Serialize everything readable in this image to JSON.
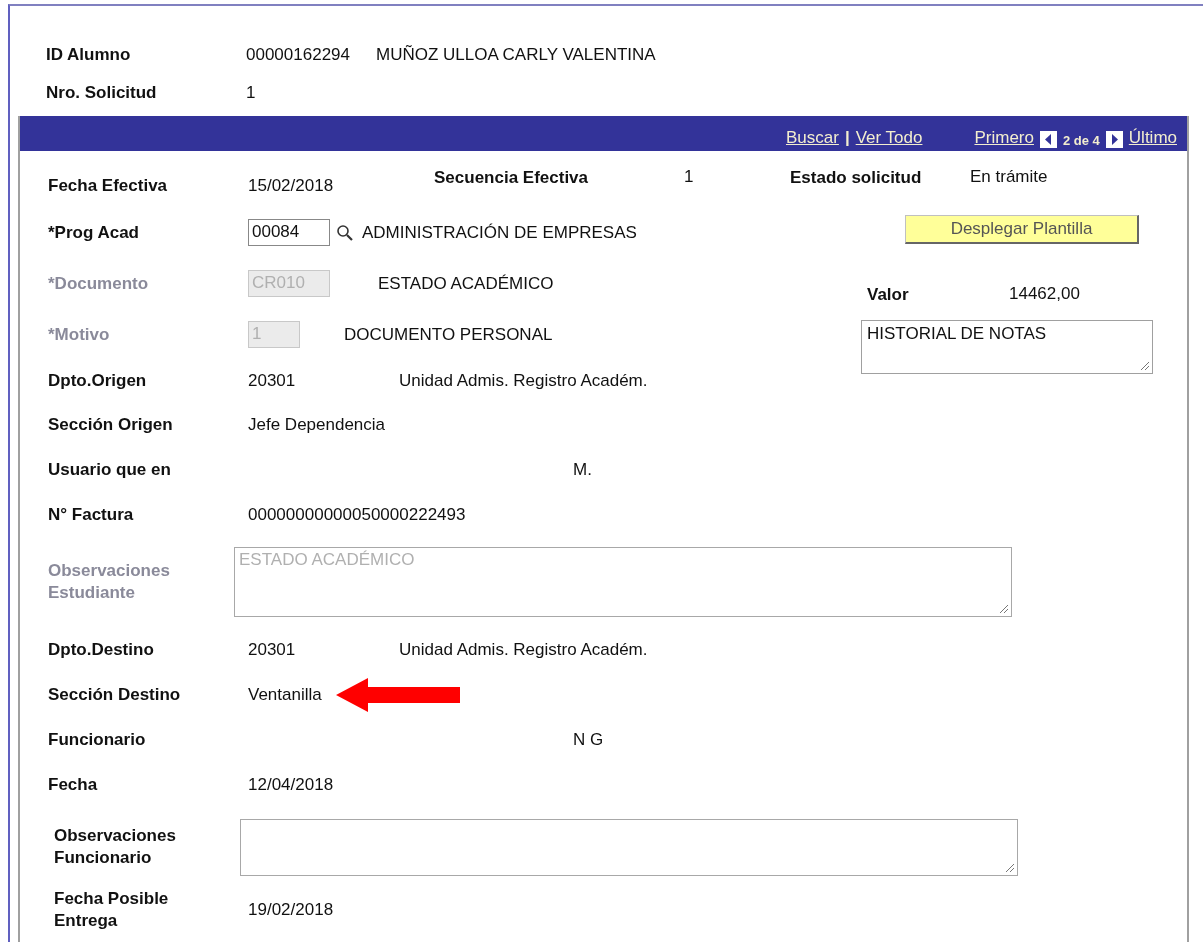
{
  "header": [
    {
      "label": "ID Alumno",
      "value": "00000162294",
      "description": "MUÑOZ ULLOA CARLY VALENTINA"
    },
    {
      "label": "Nro. Solicitud",
      "value": "1"
    }
  ],
  "panel": {
    "links": [
      {
        "kind": "link",
        "text": "Buscar"
      },
      {
        "kind": "sep",
        "text": "|"
      },
      {
        "kind": "link",
        "text": "Ver Todo"
      },
      {
        "kind": "gap"
      },
      {
        "kind": "link",
        "text": "Primero"
      },
      {
        "kind": "prev"
      },
      {
        "kind": "count",
        "text": "2 de 4"
      },
      {
        "kind": "next"
      },
      {
        "kind": "link",
        "text": "Último"
      }
    ],
    "first_row": {
      "label": "Fecha Efectiva",
      "value": "15/02/2018",
      "seq_label": "Secuencia Efectiva",
      "seq_value": "1",
      "status_label": "Estado solicitud",
      "status_value": "En trámite"
    },
    "upper_rows": [
      {
        "kind": "lookup",
        "label": "*Prog Acad",
        "value": "00084",
        "disabled": false,
        "description": "ADMINISTRACIÓN DE EMPRESAS"
      },
      {
        "kind": "input",
        "label": "*Documento",
        "value": "CR010",
        "disabled": true,
        "description": "ESTADO ACADÉMICO"
      },
      {
        "kind": "input",
        "label": "*Motivo",
        "value": "1",
        "disabled": true,
        "description": "DOCUMENTO  PERSONAL"
      },
      {
        "kind": "text",
        "label": "Dpto.Origen",
        "value": "20301",
        "description": "Unidad Admis. Registro Académ."
      }
    ],
    "side": {
      "button": "Desplegar  Plantilla",
      "value_label": "Valor",
      "value": "14462,00",
      "note": "HISTORIAL DE NOTAS"
    },
    "rows": [
      {
        "kind": "text",
        "label": "Sección Origen",
        "value": "Jefe Dependencia"
      },
      {
        "kind": "masked",
        "label": "Usuario que en",
        "value": "M."
      },
      {
        "kind": "text",
        "label": "N° Factura",
        "value": "00000000000050000222493"
      },
      {
        "kind": "textarea",
        "label": "Observaciones Estudiante",
        "value": "ESTADO ACADÉMICO",
        "disabled": true
      },
      {
        "kind": "text",
        "label": "Dpto.Destino",
        "value": "20301",
        "description": "Unidad Admis. Registro Académ."
      },
      {
        "kind": "text",
        "label": "Sección Destino",
        "value": "Ventanilla",
        "arrow": true
      },
      {
        "kind": "masked",
        "label": "Funcionario",
        "value": "N G"
      },
      {
        "kind": "text",
        "label": "Fecha",
        "value": "12/04/2018"
      },
      {
        "kind": "textarea",
        "label": "Observaciones Funcionario",
        "value": "",
        "disabled": false
      },
      {
        "kind": "text",
        "label": "Fecha Posible Entrega",
        "value": "19/02/2018"
      }
    ]
  }
}
